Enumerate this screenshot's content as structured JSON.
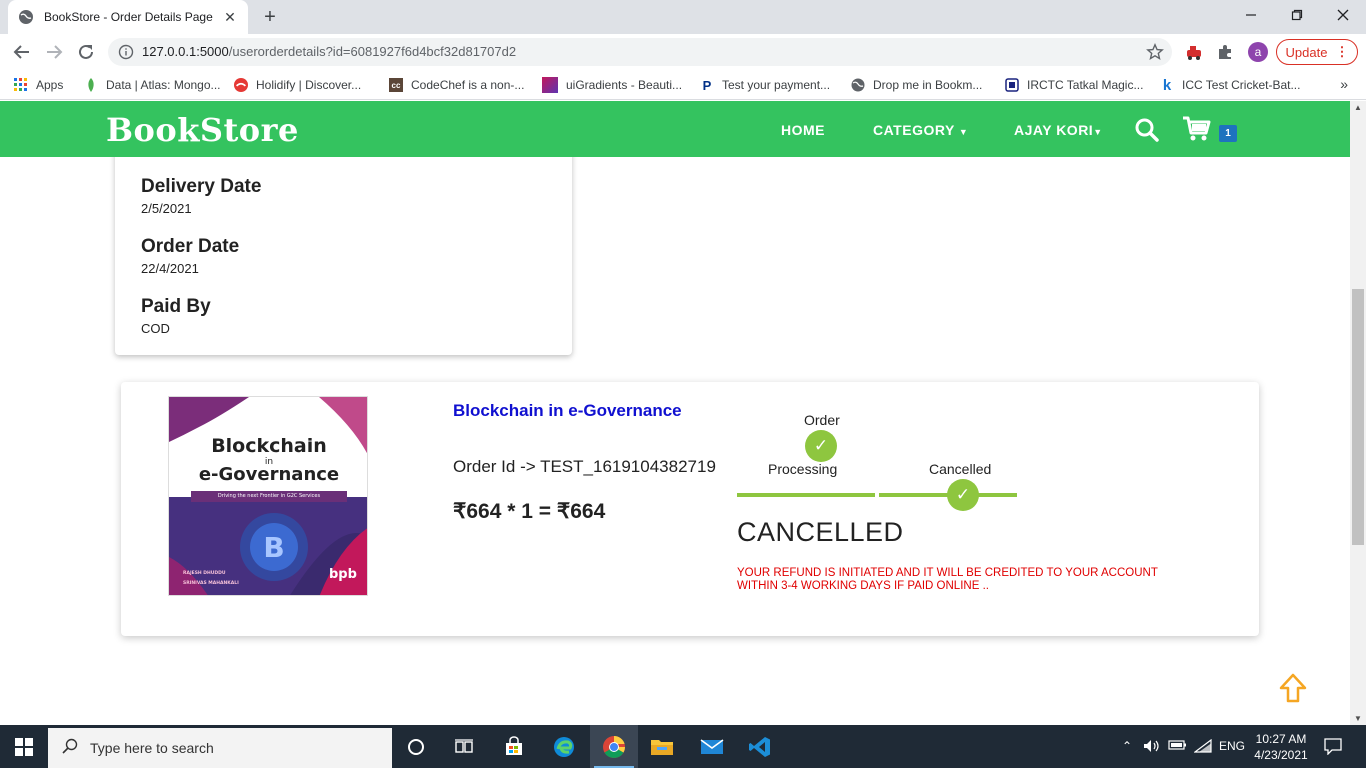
{
  "browser": {
    "tab_title": "BookStore - Order Details Page",
    "url_host": "127.0.0.1:5000",
    "url_path": "/userorderdetails?id=6081927f6d4bcf32d81707d2",
    "update_label": "Update",
    "bookmarks": [
      {
        "label": "Apps",
        "icon": "apps-grid-icon"
      },
      {
        "label": "Data | Atlas: Mongo...",
        "icon": "mongodb-leaf-icon"
      },
      {
        "label": "Holidify | Discover...",
        "icon": "holidify-icon"
      },
      {
        "label": "CodeChef is a non-...",
        "icon": "codechef-icon"
      },
      {
        "label": "uiGradients - Beauti...",
        "icon": "uigradients-icon"
      },
      {
        "label": "Test your payment...",
        "icon": "paypal-icon"
      },
      {
        "label": "Drop me in Bookm...",
        "icon": "globe-icon"
      },
      {
        "label": "IRCTC Tatkal Magic...",
        "icon": "irctc-icon"
      },
      {
        "label": "ICC Test Cricket-Bat...",
        "icon": "k-icon"
      }
    ],
    "colors": {
      "tabbar": "#dee1e6",
      "update_red": "#d93025"
    }
  },
  "site": {
    "logo": "BookStore",
    "nav": {
      "home": "HOME",
      "category": "CATEGORY",
      "user": "AJAY KORI"
    },
    "cart_count": "1",
    "colors": {
      "nav_green": "#34c35f",
      "link_blue": "#1010d0",
      "check_green": "#8ec63f",
      "alert_red": "#e00000"
    }
  },
  "order_info": {
    "delivery_label": "Delivery Date",
    "delivery_value": "2/5/2021",
    "order_label": "Order Date",
    "order_value": "22/4/2021",
    "paid_label": "Paid By",
    "paid_value": "COD"
  },
  "order_item": {
    "book_title": "Blockchain in e-Governance",
    "cover": {
      "line1": "Blockchain",
      "line2": "in",
      "line3": "e-Governance",
      "tagline": "Driving the next Frontier in G2C Services",
      "author1": "RAJESH DHUDDU",
      "author2": "SRINIVAS MAHANKALI",
      "publisher": "bpb"
    },
    "order_id": "Order Id -> TEST_1619104382719",
    "price_line": "₹664 * 1 = ₹664",
    "tracker": {
      "step1_top": "Order",
      "step1_bottom": "Processing",
      "step2": "Cancelled",
      "check": "✓"
    },
    "status": "CANCELLED",
    "refund_note": "YOUR REFUND IS INITIATED AND IT WILL BE CREDITED TO YOUR ACCOUNT WITHIN 3-4 WORKING DAYS IF PAID ONLINE .."
  },
  "taskbar": {
    "search_placeholder": "Type here to search",
    "lang": "ENG",
    "time": "10:27 AM",
    "date": "4/23/2021"
  }
}
